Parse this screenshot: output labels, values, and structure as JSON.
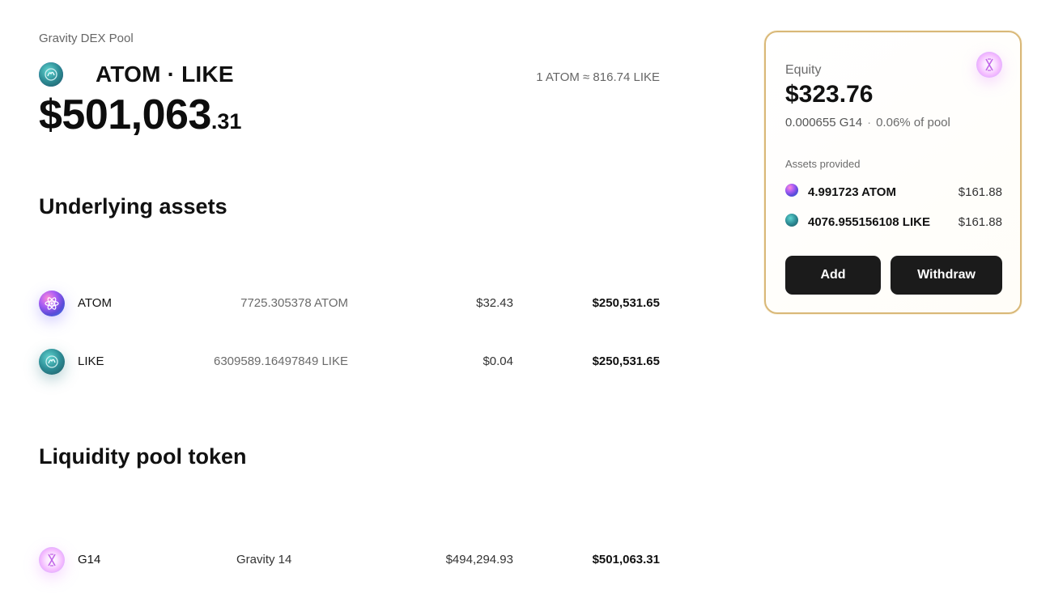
{
  "header": {
    "breadcrumb": "Gravity DEX Pool",
    "pair_title": "ATOM · LIKE",
    "rate": "1 ATOM ≈ 816.74 LIKE",
    "tvl_main": "$501,063",
    "tvl_cents": ".31"
  },
  "underlying": {
    "title": "Underlying assets",
    "rows": [
      {
        "symbol": "ATOM",
        "amount": "7725.305378 ATOM",
        "price": "$32.43",
        "value": "$250,531.65",
        "icon": "atom-icon"
      },
      {
        "symbol": "LIKE",
        "amount": "6309589.16497849 LIKE",
        "price": "$0.04",
        "value": "$250,531.65",
        "icon": "like-icon"
      }
    ]
  },
  "lp_token": {
    "title": "Liquidity pool token",
    "rows": [
      {
        "symbol": "G14",
        "name": "Gravity 14",
        "price": "$494,294.93",
        "value": "$501,063.31",
        "icon": "g14-icon"
      }
    ]
  },
  "equity_card": {
    "label": "Equity",
    "value": "$323.76",
    "lp_amount": "0.000655 G14",
    "separator": "·",
    "pool_share": "0.06% of pool",
    "assets_label": "Assets provided",
    "assets": [
      {
        "amount": "4.991723 ATOM",
        "usd": "$161.88",
        "icon": "atom-icon"
      },
      {
        "amount": "4076.955156108 LIKE",
        "usd": "$161.88",
        "icon": "like-icon"
      }
    ],
    "add_label": "Add",
    "withdraw_label": "Withdraw"
  },
  "colors": {
    "card_border": "#d9b878",
    "button_bg": "#1b1b1b",
    "button_text": "#ffffff"
  }
}
